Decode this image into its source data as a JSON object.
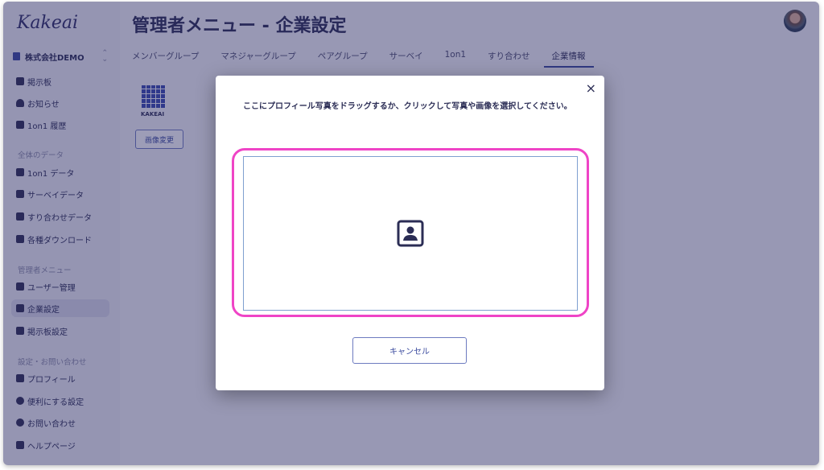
{
  "app": {
    "logo": "Kakeai"
  },
  "sidebar": {
    "company": "株式会社DEMO",
    "items_top": [
      {
        "label": "掲示板"
      },
      {
        "label": "お知らせ"
      },
      {
        "label": "1on1 履歴"
      }
    ],
    "section_data": "全体のデータ",
    "items_data": [
      {
        "label": "1on1 データ"
      },
      {
        "label": "サーベイデータ"
      },
      {
        "label": "すり合わせデータ"
      },
      {
        "label": "各種ダウンロード"
      }
    ],
    "section_admin": "管理者メニュー",
    "items_admin": [
      {
        "label": "ユーザー管理"
      },
      {
        "label": "企業設定"
      },
      {
        "label": "掲示板設定"
      }
    ],
    "section_settings": "設定・お問い合わせ",
    "items_settings": [
      {
        "label": "プロフィール"
      },
      {
        "label": "便利にする設定"
      },
      {
        "label": "お問い合わせ"
      },
      {
        "label": "ヘルプページ"
      }
    ]
  },
  "main": {
    "title": "管理者メニュー - 企業設定",
    "tabs": [
      "メンバーグループ",
      "マネジャーグループ",
      "ペアグループ",
      "サーベイ",
      "1on1",
      "すり合わせ",
      "企業情報"
    ],
    "logo_label": "KAKEAI",
    "change_image": "画像変更"
  },
  "modal": {
    "instruction": "ここにプロフィール写真をドラッグするか、クリックして写真や画像を選択してください。",
    "cancel": "キャンセル",
    "close": "×"
  },
  "colors": {
    "highlight": "#ef44c6",
    "accent": "#3a4a9e"
  }
}
